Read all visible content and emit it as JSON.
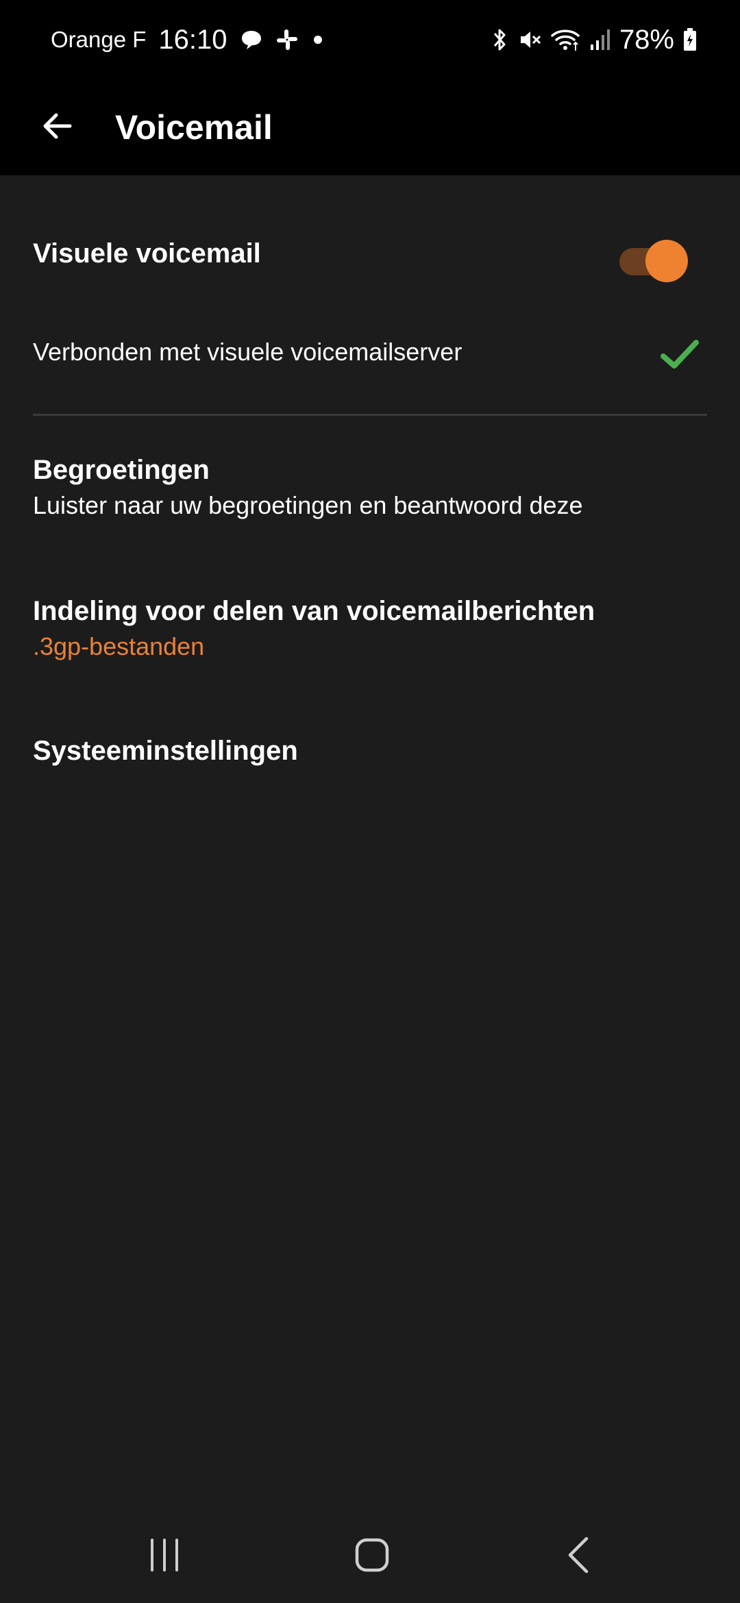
{
  "status_bar": {
    "carrier": "Orange F",
    "time": "16:10",
    "battery": "78%"
  },
  "app_bar": {
    "title": "Voicemail"
  },
  "settings": {
    "visual_voicemail": {
      "title": "Visuele voicemail",
      "enabled": true
    },
    "connection": {
      "text": "Verbonden met visuele voicemailserver"
    },
    "greetings": {
      "title": "Begroetingen",
      "subtitle": "Luister naar uw begroetingen en beantwoord deze"
    },
    "share_format": {
      "title": "Indeling voor delen van voicemailberichten",
      "value": ".3gp-bestanden"
    },
    "system_settings": {
      "title": "Systeeminstellingen"
    }
  },
  "colors": {
    "accent": "#ee8231",
    "accent_text": "#e8823a",
    "toggle_track": "#6b3f1f",
    "check": "#4caf50",
    "background": "#1c1c1c",
    "bar_background": "#000000"
  },
  "icons": {
    "status_left": [
      "chat-bubble-icon",
      "slack-icon",
      "dot-icon"
    ],
    "status_right": [
      "bluetooth-icon",
      "mute-icon",
      "wifi-icon",
      "signal-icon",
      "battery-icon"
    ],
    "nav": [
      "recent-apps-icon",
      "home-icon",
      "back-nav-icon"
    ]
  }
}
